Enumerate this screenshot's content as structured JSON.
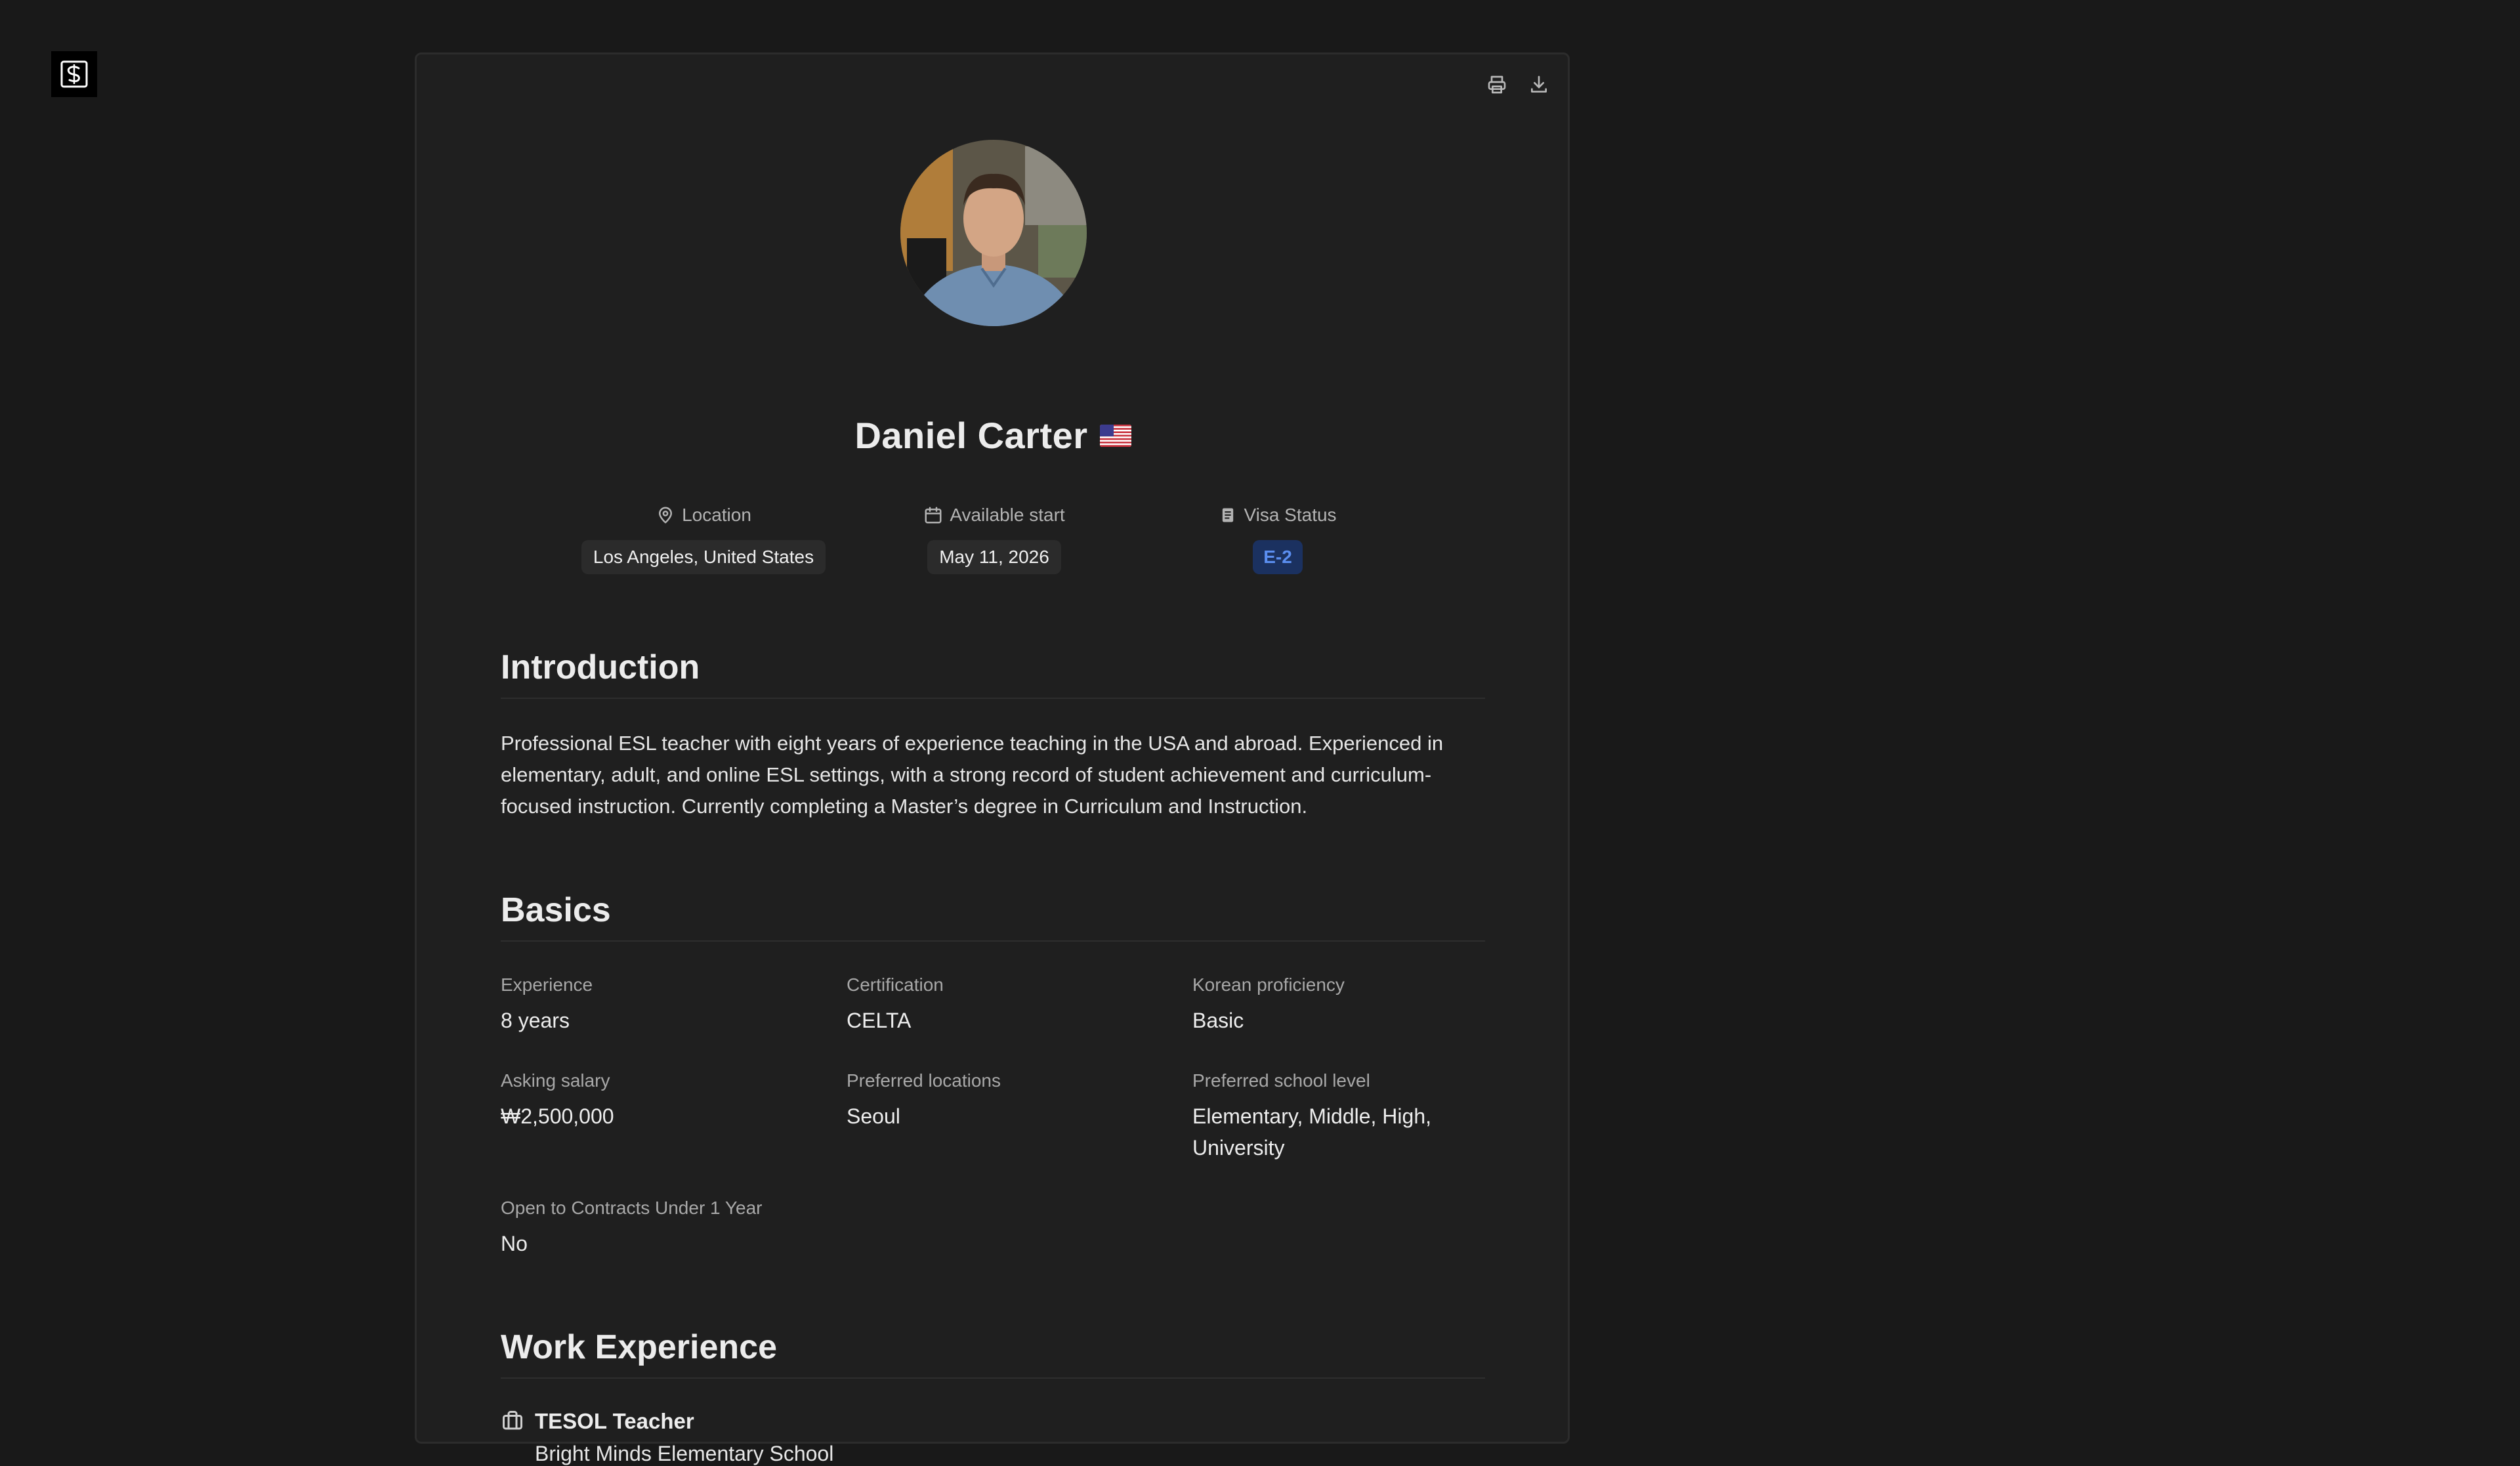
{
  "profile": {
    "name": "Daniel Carter",
    "flag": "US",
    "meta": {
      "location_label": "Location",
      "location_value": "Los Angeles, United States",
      "start_label": "Available start",
      "start_value": "May 11, 2026",
      "visa_label": "Visa Status",
      "visa_value": "E-2"
    }
  },
  "introduction": {
    "title": "Introduction",
    "text": "Professional ESL teacher with eight years of experience teaching in the USA and abroad. Experienced in elementary, adult, and online ESL settings, with a strong record of student achievement and curriculum-focused instruction. Currently completing a Master’s degree in Curriculum and Instruction."
  },
  "basics": {
    "title": "Basics",
    "fields": [
      {
        "label": "Experience",
        "value": "8 years"
      },
      {
        "label": "Certification",
        "value": "CELTA"
      },
      {
        "label": "Korean proficiency",
        "value": "Basic"
      },
      {
        "label": "Asking salary",
        "value": "₩2,500,000"
      },
      {
        "label": "Preferred locations",
        "value": "Seoul"
      },
      {
        "label": "Preferred school level",
        "value": "Elementary, Middle, High, University"
      },
      {
        "label": "Open to Contracts Under 1 Year",
        "value": "No"
      }
    ]
  },
  "work": {
    "title": "Work Experience",
    "jobs": [
      {
        "title": "TESOL Teacher",
        "company": "Bright Minds Elementary School"
      }
    ]
  },
  "icons": {
    "logo": "logo-s-icon",
    "print": "printer-icon",
    "download": "download-icon",
    "location": "map-pin-icon",
    "calendar": "calendar-icon",
    "visa": "document-icon",
    "briefcase": "briefcase-icon"
  },
  "colors": {
    "background": "#191919",
    "card": "#1f1f1f",
    "visa_chip_bg": "#1b3160",
    "visa_chip_text": "#5b8ef0"
  }
}
